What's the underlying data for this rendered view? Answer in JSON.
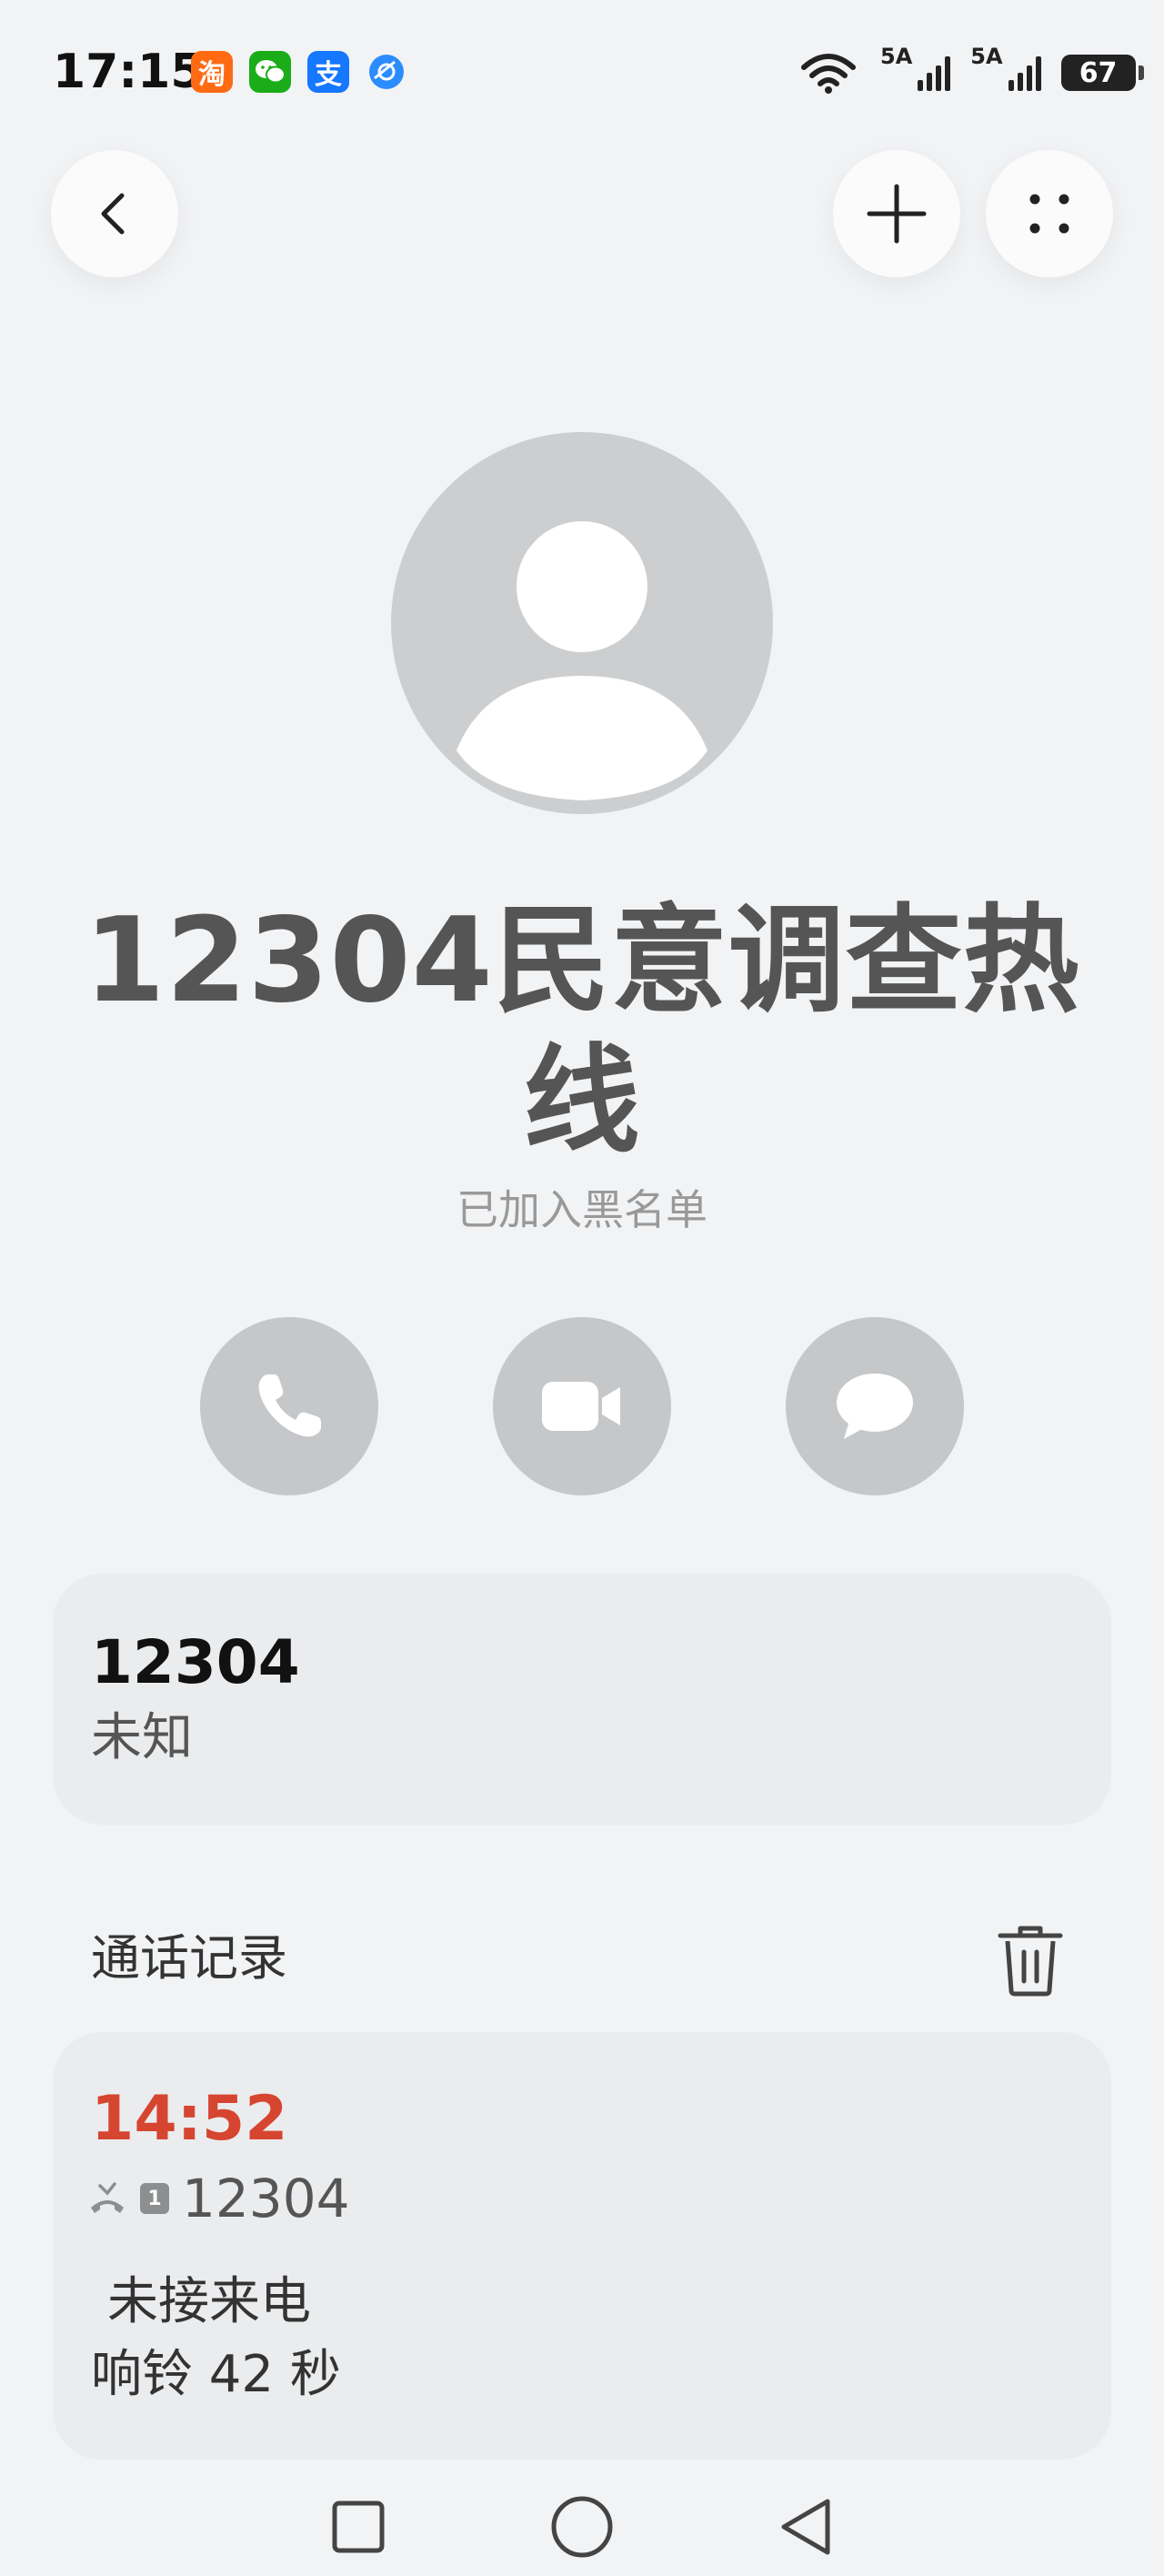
{
  "status_bar": {
    "time": "17:15",
    "app_icons": [
      {
        "name": "taobao-icon",
        "glyph": "淘",
        "color": "#ff6a13"
      },
      {
        "name": "wechat-icon",
        "glyph": "",
        "color": "#1aad19"
      },
      {
        "name": "alipay-icon",
        "glyph": "支",
        "color": "#1677ff"
      },
      {
        "name": "browser-icon",
        "glyph": "",
        "color": "#2b8cff"
      }
    ],
    "signal_1_label": "5A",
    "signal_2_label": "5A",
    "battery": "67"
  },
  "contact": {
    "name": "12304民意调查热线",
    "status": "已加入黑名单"
  },
  "actions": {
    "call": "phone-icon",
    "video": "video-icon",
    "message": "message-icon"
  },
  "number_card": {
    "number": "12304",
    "location": "未知"
  },
  "call_log": {
    "title": "通话记录",
    "entries": [
      {
        "time": "14:52",
        "sim": "1",
        "number": "12304",
        "type": " 未接来电",
        "ring": "响铃 42 秒"
      }
    ]
  },
  "colors": {
    "background": "#f2f3f5",
    "card": "#ebecee",
    "missed": "#d64530",
    "action_button": "#c6c7c9"
  }
}
